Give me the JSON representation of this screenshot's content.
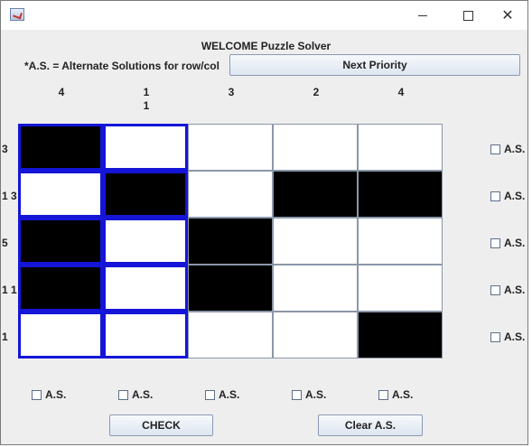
{
  "window": {
    "title": ""
  },
  "header": {
    "welcome": "WELCOME Puzzle Solver",
    "as_note": "*A.S. = Alternate Solutions for row/col",
    "next_priority": "Next Priority"
  },
  "column_clues": [
    [
      "4"
    ],
    [
      "1",
      "1"
    ],
    [
      "3"
    ],
    [
      "2"
    ],
    [
      "4"
    ]
  ],
  "row_clues": [
    "3",
    "1 3",
    "5",
    "1 1",
    "1"
  ],
  "grid": [
    [
      1,
      0,
      0,
      0,
      0
    ],
    [
      0,
      1,
      0,
      1,
      1
    ],
    [
      1,
      0,
      1,
      0,
      0
    ],
    [
      1,
      0,
      1,
      0,
      0
    ],
    [
      0,
      0,
      0,
      0,
      1
    ]
  ],
  "highlighted_columns": [
    0,
    1
  ],
  "as_label": "A.S.",
  "row_as_checkboxes": [
    false,
    false,
    false,
    false,
    false
  ],
  "col_as_checkboxes": [
    false,
    false,
    false,
    false,
    false
  ],
  "buttons": {
    "check": "CHECK",
    "clear": "Clear A.S."
  }
}
